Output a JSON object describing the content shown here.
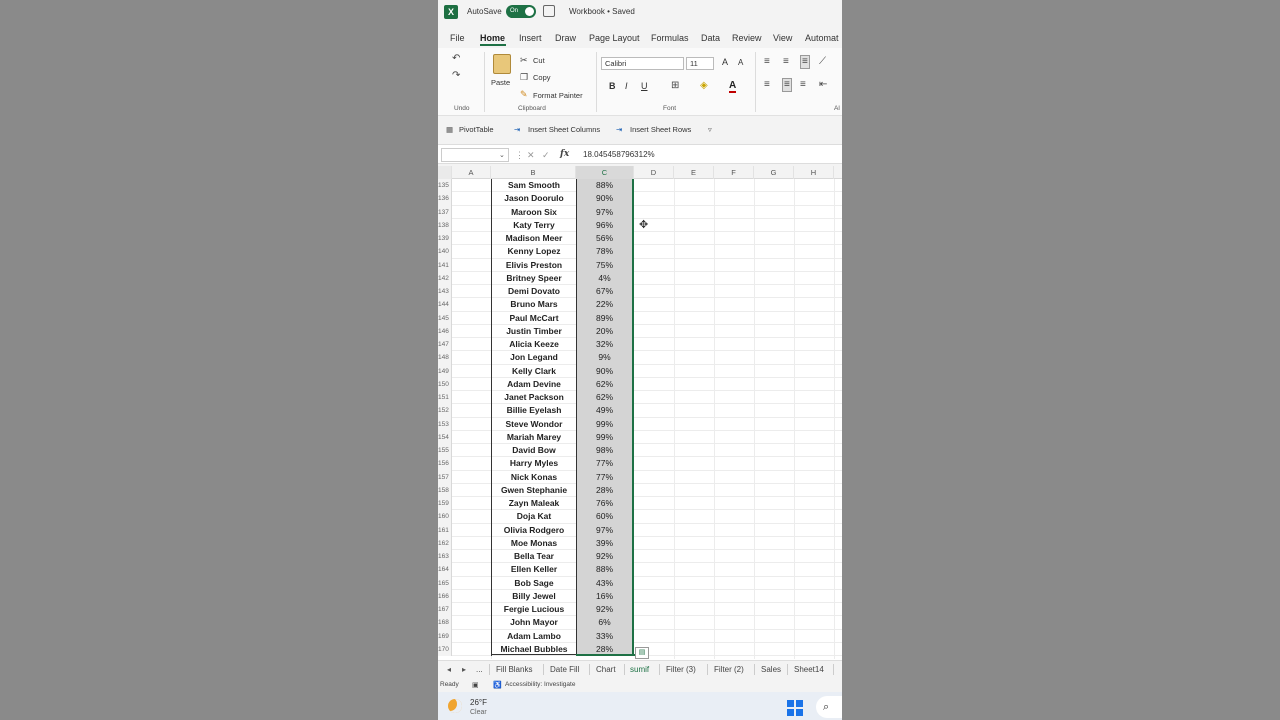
{
  "titlebar": {
    "app_logo": "X",
    "autosave_label": "AutoSave",
    "autosave_state": "On",
    "doc_title": "Workbook • Saved"
  },
  "menu": {
    "items": [
      "File",
      "Home",
      "Insert",
      "Draw",
      "Page Layout",
      "Formulas",
      "Data",
      "Review",
      "View",
      "Automat"
    ]
  },
  "ribbon": {
    "undo_label": "Undo",
    "paste_label": "Paste",
    "cut_label": "Cut",
    "copy_label": "Copy",
    "format_painter_label": "Format Painter",
    "clipboard_label": "Clipboard",
    "font_name": "Calibri",
    "font_size": "11",
    "font_label": "Font",
    "bold": "B",
    "italic": "I",
    "underline": "U",
    "grow_font": "A",
    "shrink_font": "A",
    "font_color": "A",
    "align_label": "Al"
  },
  "sheetbar": {
    "pivot": "PivotTable",
    "insert_cols": "Insert Sheet Columns",
    "insert_rows": "Insert Sheet Rows"
  },
  "formula_bar": {
    "fx": "fx",
    "value": "18.045458796312%"
  },
  "grid": {
    "columns": [
      "A",
      "B",
      "C",
      "D",
      "E",
      "F",
      "G",
      "H"
    ],
    "rows": [
      {
        "n": "135",
        "name": "Sam Smooth",
        "pct": "88%"
      },
      {
        "n": "136",
        "name": "Jason Doorulo",
        "pct": "90%"
      },
      {
        "n": "137",
        "name": "Maroon Six",
        "pct": "97%"
      },
      {
        "n": "138",
        "name": "Katy Terry",
        "pct": "96%"
      },
      {
        "n": "139",
        "name": "Madison Meer",
        "pct": "56%"
      },
      {
        "n": "140",
        "name": "Kenny Lopez",
        "pct": "78%"
      },
      {
        "n": "141",
        "name": "Elivis Preston",
        "pct": "75%"
      },
      {
        "n": "142",
        "name": "Britney Speer",
        "pct": "4%"
      },
      {
        "n": "143",
        "name": "Demi Dovato",
        "pct": "67%"
      },
      {
        "n": "144",
        "name": "Bruno Mars",
        "pct": "22%"
      },
      {
        "n": "145",
        "name": "Paul McCart",
        "pct": "89%"
      },
      {
        "n": "146",
        "name": "Justin Timber",
        "pct": "20%"
      },
      {
        "n": "147",
        "name": "Alicia Keeze",
        "pct": "32%"
      },
      {
        "n": "148",
        "name": "Jon Legand",
        "pct": "9%"
      },
      {
        "n": "149",
        "name": "Kelly Clark",
        "pct": "90%"
      },
      {
        "n": "150",
        "name": "Adam Devine",
        "pct": "62%"
      },
      {
        "n": "151",
        "name": "Janet Packson",
        "pct": "62%"
      },
      {
        "n": "152",
        "name": "Billie Eyelash",
        "pct": "49%"
      },
      {
        "n": "153",
        "name": "Steve Wondor",
        "pct": "99%"
      },
      {
        "n": "154",
        "name": "Mariah Marey",
        "pct": "99%"
      },
      {
        "n": "155",
        "name": "David Bow",
        "pct": "98%"
      },
      {
        "n": "156",
        "name": "Harry Myles",
        "pct": "77%"
      },
      {
        "n": "157",
        "name": "Nick Konas",
        "pct": "77%"
      },
      {
        "n": "158",
        "name": "Gwen Stephanie",
        "pct": "28%"
      },
      {
        "n": "159",
        "name": "Zayn Maleak",
        "pct": "76%"
      },
      {
        "n": "160",
        "name": "Doja Kat",
        "pct": "60%"
      },
      {
        "n": "161",
        "name": "Olivia Rodgero",
        "pct": "97%"
      },
      {
        "n": "162",
        "name": "Moe Monas",
        "pct": "39%"
      },
      {
        "n": "163",
        "name": "Bella Tear",
        "pct": "92%"
      },
      {
        "n": "164",
        "name": "Ellen Keller",
        "pct": "88%"
      },
      {
        "n": "165",
        "name": "Bob Sage",
        "pct": "43%"
      },
      {
        "n": "166",
        "name": "Billy Jewel",
        "pct": "16%"
      },
      {
        "n": "167",
        "name": "Fergie Lucious",
        "pct": "92%"
      },
      {
        "n": "168",
        "name": "John Mayor",
        "pct": "6%"
      },
      {
        "n": "169",
        "name": "Adam Lambo",
        "pct": "33%"
      },
      {
        "n": "170",
        "name": "Michael Bubbles",
        "pct": "28%"
      }
    ]
  },
  "tabs": {
    "more": "...",
    "items": [
      "Fill Blanks",
      "Date Fill",
      "Chart",
      "sumif",
      "Filter (3)",
      "Filter (2)",
      "Sales",
      "Sheet14"
    ]
  },
  "status": {
    "ready": "Ready",
    "accessibility": "Accessibility: Investigate"
  },
  "taskbar": {
    "temp": "26°F",
    "condition": "Clear"
  },
  "colors": {
    "excel_green": "#1e7145",
    "selection_fill": "#d4d4d4"
  }
}
